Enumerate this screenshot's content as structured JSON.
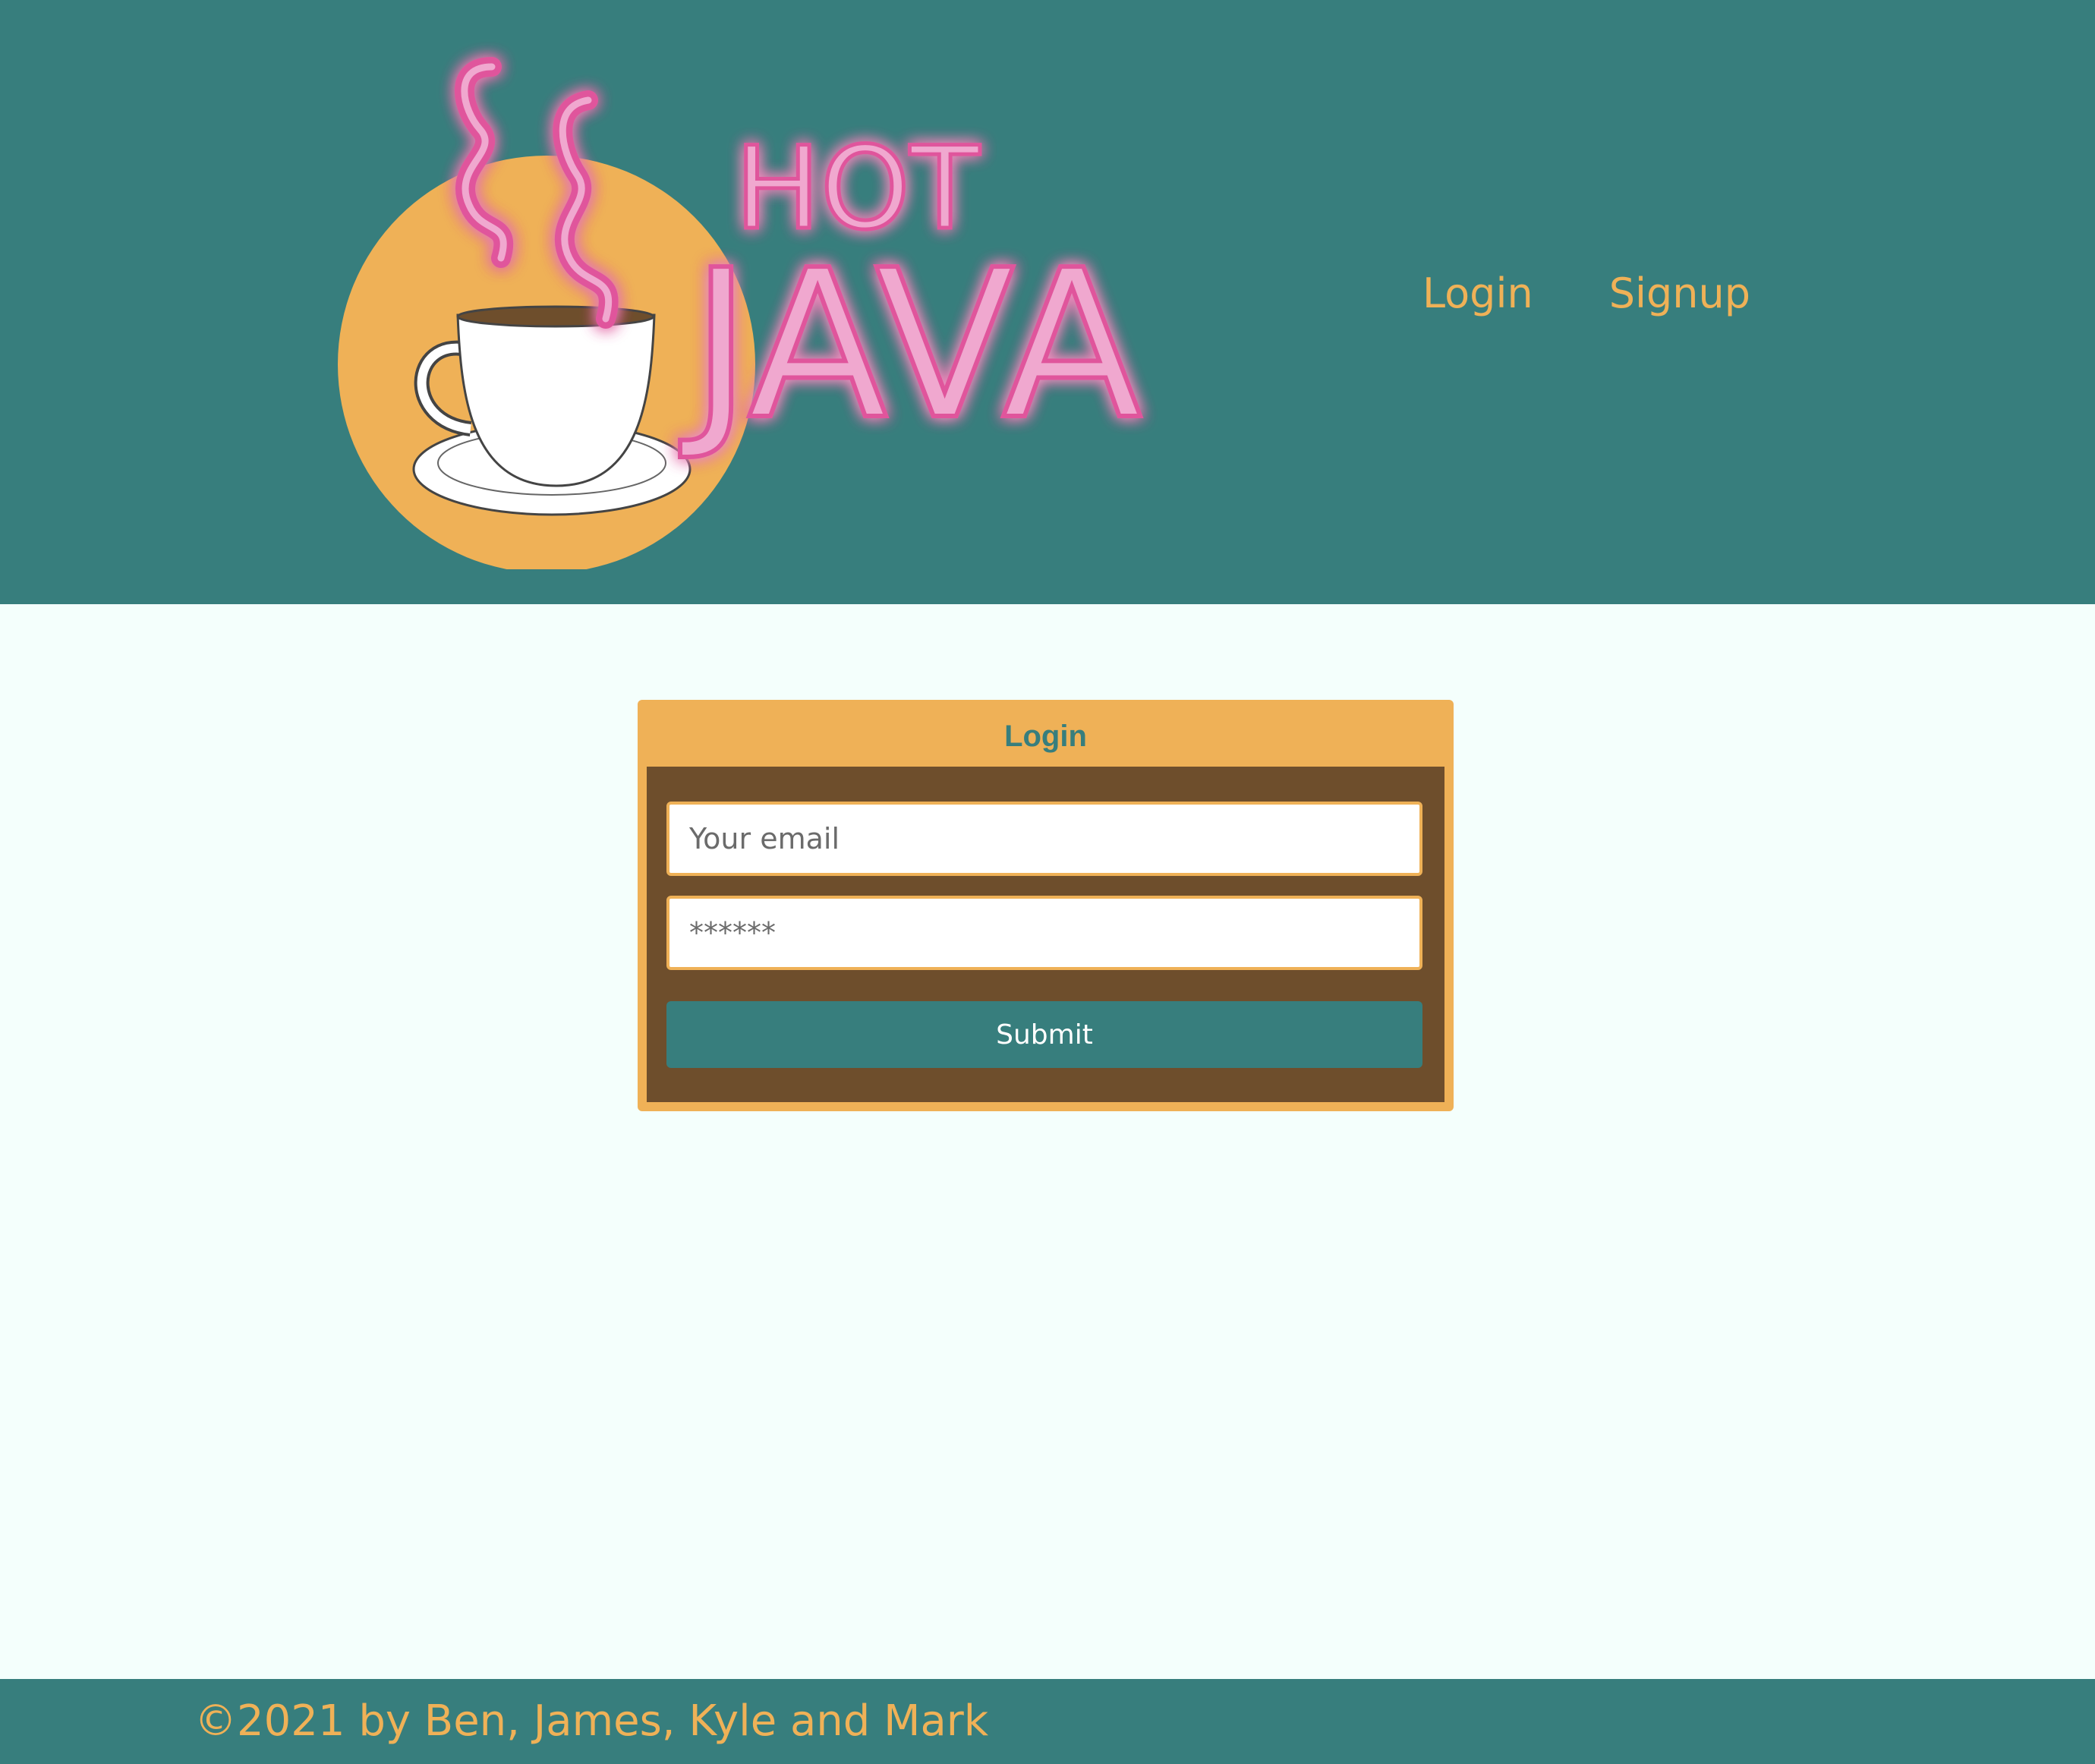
{
  "header": {
    "logo": {
      "text_top": "HOT",
      "text_bottom": "JAVA",
      "icon": "coffee-cup-icon"
    },
    "nav": {
      "login": "Login",
      "signup": "Signup"
    }
  },
  "login_form": {
    "title": "Login",
    "email_placeholder": "Your email",
    "password_placeholder": "******",
    "submit": "Submit"
  },
  "footer": {
    "text": "©2021 by Ben, James, Kyle and Mark"
  },
  "colors": {
    "teal": "#377e7d",
    "orange": "#efb157",
    "brown": "#6e4e2c",
    "page_bg": "#f4fffc",
    "neon_pink": "#e0559c"
  }
}
